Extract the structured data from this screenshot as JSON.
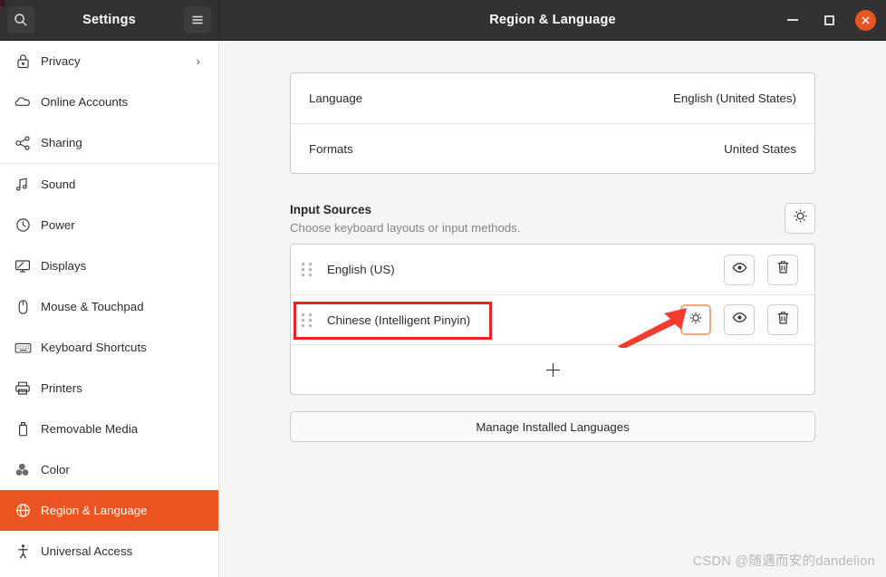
{
  "window": {
    "app_title": "Settings",
    "page_title": "Region & Language",
    "search_icon": "search-icon",
    "menu_icon": "hamburger-menu-icon",
    "minimize_label": "Minimize",
    "maximize_label": "Maximize",
    "close_label": "Close",
    "close_glyph": "✕",
    "accent_color": "#e95420",
    "titlebar_color": "#333232"
  },
  "sidebar": {
    "items": [
      {
        "label": "Privacy",
        "icon": "lock-icon",
        "active": false,
        "chevron": "›"
      },
      {
        "label": "Online Accounts",
        "icon": "cloud-icon",
        "active": false,
        "chevron": ""
      },
      {
        "label": "Sharing",
        "icon": "share-nodes-icon",
        "active": false,
        "chevron": ""
      },
      {
        "label": "Sound",
        "icon": "music-note-icon",
        "active": false,
        "chevron": ""
      },
      {
        "label": "Power",
        "icon": "power-icon",
        "active": false,
        "chevron": ""
      },
      {
        "label": "Displays",
        "icon": "display-icon",
        "active": false,
        "chevron": ""
      },
      {
        "label": "Mouse & Touchpad",
        "icon": "mouse-icon",
        "active": false,
        "chevron": ""
      },
      {
        "label": "Keyboard Shortcuts",
        "icon": "keyboard-icon",
        "active": false,
        "chevron": ""
      },
      {
        "label": "Printers",
        "icon": "printer-icon",
        "active": false,
        "chevron": ""
      },
      {
        "label": "Removable Media",
        "icon": "usb-drive-icon",
        "active": false,
        "chevron": ""
      },
      {
        "label": "Color",
        "icon": "color-profile-icon",
        "active": false,
        "chevron": ""
      },
      {
        "label": "Region & Language",
        "icon": "globe-icon",
        "active": true,
        "chevron": ""
      },
      {
        "label": "Universal Access",
        "icon": "accessibility-icon",
        "active": false,
        "chevron": ""
      }
    ]
  },
  "main": {
    "locale_card": {
      "rows": [
        {
          "label": "Language",
          "value": "English (United States)"
        },
        {
          "label": "Formats",
          "value": "United States"
        }
      ]
    },
    "input_sources": {
      "title": "Input Sources",
      "subtitle": "Choose keyboard layouts or input methods.",
      "settings_icon": "gear-icon",
      "sources": [
        {
          "name": "English (US)",
          "handle_icon": "drag-handle-icon",
          "has_preferences": false,
          "show_icon": "eye-icon",
          "remove_icon": "trash-icon"
        },
        {
          "name": "Chinese (Intelligent Pinyin)",
          "handle_icon": "drag-handle-icon",
          "has_preferences": true,
          "preferences_icon": "gear-icon",
          "show_icon": "eye-icon",
          "remove_icon": "trash-icon"
        }
      ],
      "add_label": "Add Input Source",
      "add_icon": "plus-icon"
    },
    "manage_languages_label": "Manage Installed Languages"
  },
  "annotations": {
    "highlight_color": "#ee2222",
    "arrow_color": "#f33b30",
    "focus_ring_color": "#f0a884"
  },
  "watermark": "CSDN @随遇而安的dandelion"
}
